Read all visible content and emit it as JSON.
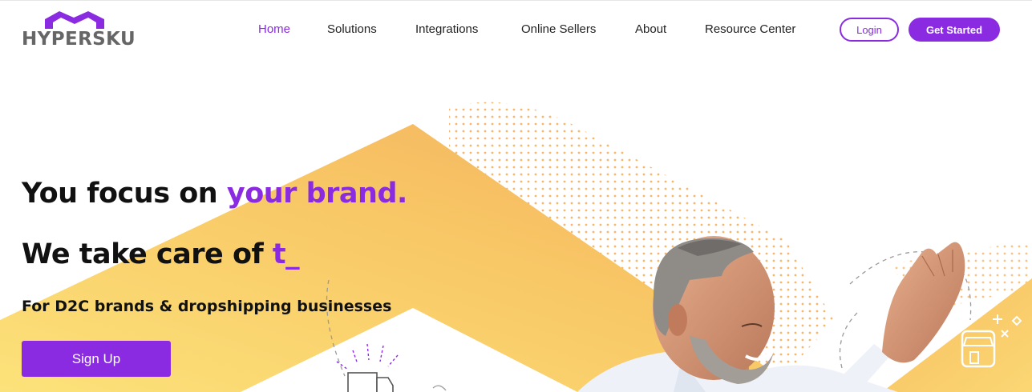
{
  "header": {
    "logo_text": "HYPERSKU",
    "nav": [
      {
        "label": "Home",
        "active": true
      },
      {
        "label": "Solutions",
        "active": false
      },
      {
        "label": "Integrations",
        "active": false
      },
      {
        "label": "Online Sellers",
        "active": false
      },
      {
        "label": "About",
        "active": false
      },
      {
        "label": "Resource Center",
        "active": false
      }
    ],
    "login_label": "Login",
    "get_started_label": "Get Started"
  },
  "hero": {
    "line1_prefix": "You focus on ",
    "line1_accent": "your brand.",
    "line2_prefix": "We take care of ",
    "line2_accent": "t_",
    "subtitle": "For D2C brands & dropshipping businesses",
    "signup_label": "Sign Up"
  },
  "colors": {
    "accent": "#8a2be2",
    "yellow_light": "#fbd96c",
    "yellow_orange": "#f5b55e",
    "text": "#111111"
  },
  "icons": [
    "logo-roof-icon",
    "delivery-truck-icon",
    "storefront-icon",
    "sparkle-icon"
  ]
}
